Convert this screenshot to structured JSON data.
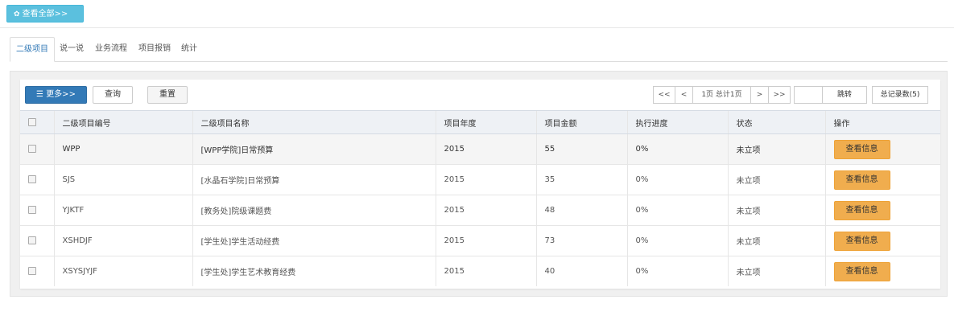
{
  "top": {
    "view_all_icon": "gear-icon",
    "view_all_label": "查看全部>>"
  },
  "tabs": [
    "二级项目",
    "说一说",
    "业务流程",
    "项目报销",
    "统计"
  ],
  "toolbar": {
    "more_icon": "list-icon",
    "more_label": "更多>>",
    "query_label": "查询",
    "reset_label": "重置"
  },
  "pager": {
    "first": "<<",
    "prev": "<",
    "page_info": "1页 总计1页",
    "next": ">",
    "last": ">>",
    "jump_value": "",
    "jump_label": "跳转",
    "total_label": "总记录数(5)"
  },
  "table": {
    "headers": [
      "二级项目编号",
      "二级项目名称",
      "项目年度",
      "项目金额",
      "执行进度",
      "状态",
      "操作"
    ],
    "rows": [
      {
        "code": "WPP",
        "name": "[WPP学院]日常预算",
        "year": "2015",
        "amount": "55",
        "progress": "0%",
        "status": "未立项",
        "action": "查看信息"
      },
      {
        "code": "SJS",
        "name": "[水晶石学院]日常预算",
        "year": "2015",
        "amount": "35",
        "progress": "0%",
        "status": "未立项",
        "action": "查看信息"
      },
      {
        "code": "YJKTF",
        "name": "[教务处]院级课题费",
        "year": "2015",
        "amount": "48",
        "progress": "0%",
        "status": "未立项",
        "action": "查看信息"
      },
      {
        "code": "XSHDJF",
        "name": "[学生处]学生活动经费",
        "year": "2015",
        "amount": "73",
        "progress": "0%",
        "status": "未立项",
        "action": "查看信息"
      },
      {
        "code": "XSYSJYJF",
        "name": "[学生处]学生艺术教育经费",
        "year": "2015",
        "amount": "40",
        "progress": "0%",
        "status": "未立项",
        "action": "查看信息"
      }
    ]
  },
  "colors": {
    "primary": "#337ab7",
    "info": "#5bc0de",
    "warning": "#f0ad4e"
  }
}
